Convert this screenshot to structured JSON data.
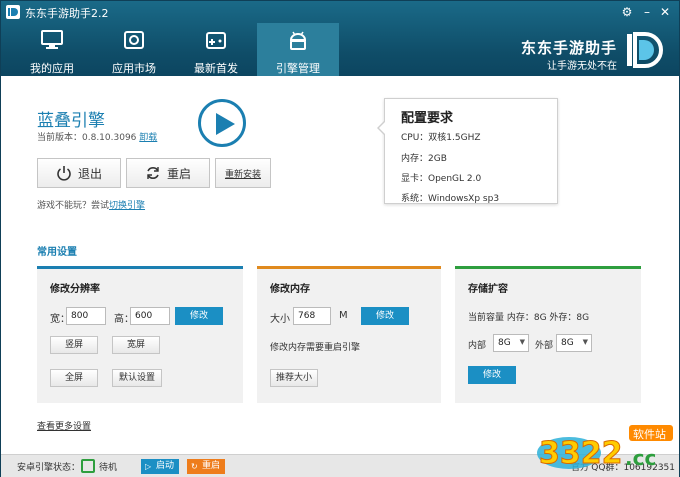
{
  "app": {
    "title": "东东手游助手2.2"
  },
  "nav": {
    "tabs": [
      {
        "label": "我的应用",
        "icon": "monitor-icon"
      },
      {
        "label": "应用市场",
        "icon": "store-icon"
      },
      {
        "label": "最新首发",
        "icon": "gamepad-icon"
      },
      {
        "label": "引擎管理",
        "icon": "android-icon",
        "active": true
      }
    ]
  },
  "brand": {
    "name": "东东手游助手",
    "slogan": "让手游无处不在",
    "logo": "dd-logo-icon"
  },
  "engine": {
    "name": "蓝叠引擎",
    "version_label": "当前版本：0.8.10.3096",
    "uninstall": "卸载",
    "exit": "退出",
    "restart": "重启",
    "reinstall": "重新安装",
    "hint_prefix": "游戏不能玩？尝试",
    "hint_link": "切换引擎"
  },
  "config": {
    "title": "配置要求",
    "rows": [
      "CPU：双核1.5GHZ",
      "内存：2GB",
      "显卡：OpenGL 2.0",
      "系统：WindowsXp sp3"
    ]
  },
  "settings": {
    "title": "常用设置",
    "resolution": {
      "title": "修改分辨率",
      "width_label": "宽：",
      "width": "800",
      "height_label": "高：",
      "height": "600",
      "apply": "修改",
      "portrait": "竖屏",
      "landscape": "宽屏",
      "fullscreen": "全屏",
      "default": "默认设置",
      "bar_color": "#1b7fb1"
    },
    "memory": {
      "title": "修改内存",
      "size_label": "大小",
      "size": "768",
      "unit": "M",
      "apply": "修改",
      "note": "修改内存需要重启引擎",
      "recommend": "推荐大小",
      "bar_color": "#e08a1e"
    },
    "storage": {
      "title": "存储扩容",
      "current": "当前容量 内存：8G 外存：8G",
      "internal_label": "内部",
      "internal": "8G",
      "external_label": "外部",
      "external": "8G",
      "apply": "修改",
      "bar_color": "#2e9e3e"
    },
    "more": "查看更多设置"
  },
  "status": {
    "label": "安卓引擎状态：",
    "state": "待机",
    "start": "启动",
    "restart": "重启",
    "right_text": "官方",
    "qq": "QQ群：106192351"
  },
  "watermark": {
    "number": "3322",
    "suffix": ".cc",
    "site": "软件站"
  }
}
